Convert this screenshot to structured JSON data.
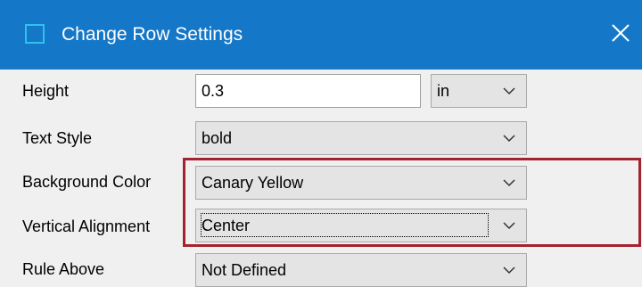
{
  "dialog": {
    "title": "Change Row Settings",
    "icons": {
      "app": "window-icon",
      "close": "close-icon"
    }
  },
  "fields": {
    "height": {
      "label": "Height",
      "value": "0.3",
      "unit": "in"
    },
    "text_style": {
      "label": "Text Style",
      "value": "bold"
    },
    "background_color": {
      "label": "Background Color",
      "value": "Canary Yellow"
    },
    "vertical_alignment": {
      "label": "Vertical Alignment",
      "value": "Center"
    },
    "rule_above": {
      "label": "Rule Above",
      "value": "Not Defined"
    }
  },
  "colors": {
    "title_bar": "#1577c8",
    "highlight_border": "#a2242e",
    "dialog_background": "#f0f0f0"
  }
}
